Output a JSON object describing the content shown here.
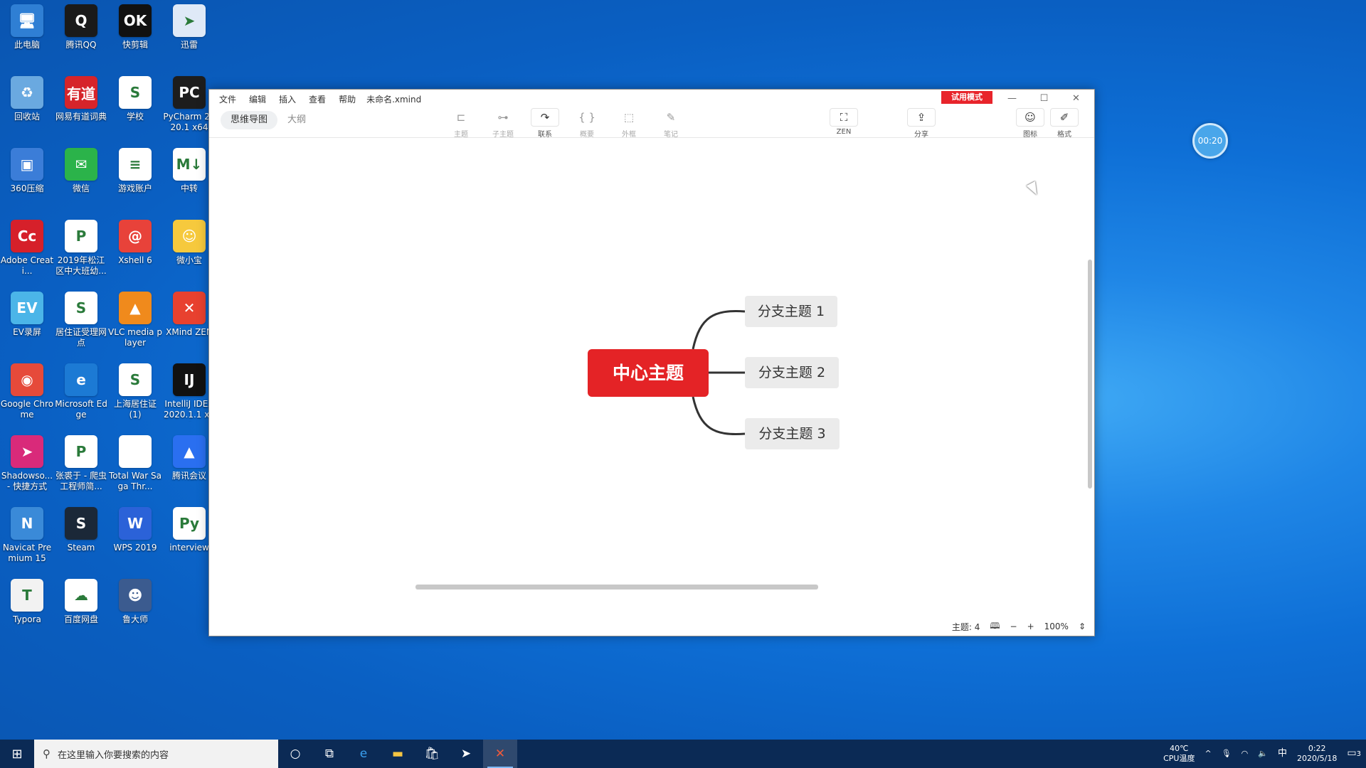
{
  "desktop": {
    "icons": [
      {
        "label": "此电脑",
        "color": "#2f7fd4",
        "glyph": "🖥"
      },
      {
        "label": "腾讯QQ",
        "color": "#1a1a1a",
        "glyph": "Q"
      },
      {
        "label": "快剪辑",
        "color": "#111111",
        "glyph": "OK"
      },
      {
        "label": "迅雷",
        "color": "#dfe9f7",
        "glyph": "➤"
      },
      {
        "label": "回收站",
        "color": "#6aa9e0",
        "glyph": "♻"
      },
      {
        "label": "网易有道词典",
        "color": "#d6242a",
        "glyph": "有道"
      },
      {
        "label": "学校",
        "color": "#ffffff",
        "glyph": "S"
      },
      {
        "label": "PyCharm 2020.1 x64",
        "color": "#1d1d1d",
        "glyph": "PC"
      },
      {
        "label": "360压缩",
        "color": "#3b7dd8",
        "glyph": "▣"
      },
      {
        "label": "微信",
        "color": "#2bb34a",
        "glyph": "✉"
      },
      {
        "label": "游戏账户",
        "color": "#ffffff",
        "glyph": "≡"
      },
      {
        "label": "中转",
        "color": "#ffffff",
        "glyph": "M↓"
      },
      {
        "label": "Adobe Creati...",
        "color": "#d6202a",
        "glyph": "Cc"
      },
      {
        "label": "2019年松江区中大班幼...",
        "color": "#ffffff",
        "glyph": "P"
      },
      {
        "label": "Xshell 6",
        "color": "#e8423a",
        "glyph": "@"
      },
      {
        "label": "微小宝",
        "color": "#f6c93d",
        "glyph": "☺"
      },
      {
        "label": "EV录屏",
        "color": "#4bb5e8",
        "glyph": "EV"
      },
      {
        "label": "居住证受理网点",
        "color": "#ffffff",
        "glyph": "S"
      },
      {
        "label": "VLC media player",
        "color": "#f08a1c",
        "glyph": "▲"
      },
      {
        "label": "XMind ZEN",
        "color": "#e8412f",
        "glyph": "✕"
      },
      {
        "label": "Google Chrome",
        "color": "#e64a3a",
        "glyph": "◉"
      },
      {
        "label": "Microsoft Edge",
        "color": "#1c7ad4",
        "glyph": "e"
      },
      {
        "label": "上海居住证(1)",
        "color": "#ffffff",
        "glyph": "S"
      },
      {
        "label": "IntelliJ IDEA 2020.1.1 x64",
        "color": "#111111",
        "glyph": "IJ"
      },
      {
        "label": "Shadowso... - 快捷方式",
        "color": "#d92a7a",
        "glyph": "➤"
      },
      {
        "label": "张裘于 - 爬虫工程师简...",
        "color": "#ffffff",
        "glyph": "P"
      },
      {
        "label": "Total War Saga Thr...",
        "color": "#ffffff",
        "glyph": ""
      },
      {
        "label": "腾讯会议",
        "color": "#2a6ff0",
        "glyph": "▲"
      },
      {
        "label": "Navicat Premium 15",
        "color": "#3a8ad8",
        "glyph": "N"
      },
      {
        "label": "Steam",
        "color": "#1b2838",
        "glyph": "S"
      },
      {
        "label": "WPS 2019",
        "color": "#2b62d8",
        "glyph": "W"
      },
      {
        "label": "interview",
        "color": "#ffffff",
        "glyph": "Py"
      },
      {
        "label": "Typora",
        "color": "#f2f2f2",
        "glyph": "T"
      },
      {
        "label": "百度网盘",
        "color": "#ffffff",
        "glyph": "☁"
      },
      {
        "label": "鲁大师",
        "color": "#3b5b8f",
        "glyph": "☻"
      }
    ]
  },
  "window": {
    "menus": [
      "文件",
      "编辑",
      "插入",
      "查看",
      "帮助"
    ],
    "filename": "未命名.xmind",
    "trial_badge": "试用模式",
    "controls": {
      "minimize": "—",
      "maximize": "☐",
      "close": "✕"
    },
    "view_tabs": [
      {
        "label": "思维导图",
        "active": true
      },
      {
        "label": "大纲",
        "active": false
      }
    ],
    "tools": [
      {
        "label": "主题",
        "glyph": "⊏"
      },
      {
        "label": "子主题",
        "glyph": "⊶"
      },
      {
        "label": "联系",
        "glyph": "↷"
      },
      {
        "label": "概要",
        "glyph": "{ }"
      },
      {
        "label": "外框",
        "glyph": "⬚"
      },
      {
        "label": "笔记",
        "glyph": "✎"
      },
      {
        "label": "ZEN",
        "glyph": "⛶"
      },
      {
        "label": "分享",
        "glyph": "⇪"
      },
      {
        "label": "图标",
        "glyph": "☺"
      },
      {
        "label": "格式",
        "glyph": "✐"
      }
    ],
    "mindmap": {
      "central": "中心主题",
      "branches": [
        "分支主题 1",
        "分支主题 2",
        "分支主题 3"
      ],
      "central_color": "#e42326"
    },
    "status": {
      "topic_count": "主题: 4",
      "zoom": "100%",
      "zoom_out": "−",
      "zoom_in": "+"
    }
  },
  "timer": "00:20",
  "taskbar": {
    "search_placeholder": "在这里输入你要搜索的内容",
    "apps": [
      "cortana",
      "task-view",
      "edge",
      "explorer",
      "store",
      "thunder",
      "xmind"
    ],
    "temp": "40℃",
    "temp_label": "CPU温度",
    "ime": "中",
    "time": "0:22",
    "date": "2020/5/18",
    "notifications": "3"
  }
}
